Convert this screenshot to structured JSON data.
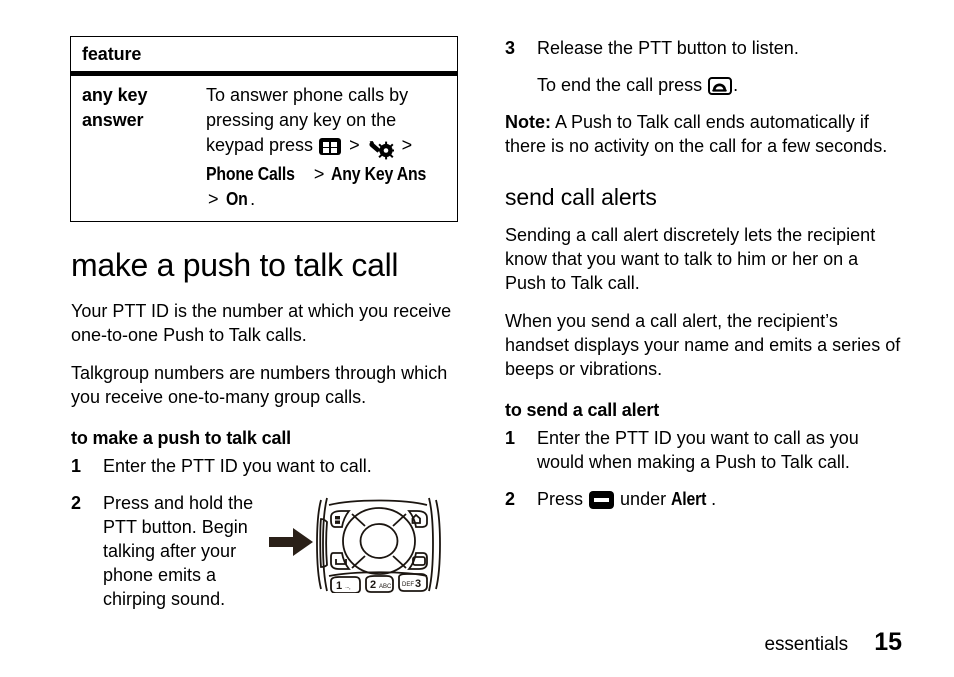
{
  "document": {
    "page_number": "15",
    "chapter_footer": "essentials"
  },
  "left_column": {
    "feature_table": {
      "header": "feature",
      "rows": [
        {
          "label": "any key answer",
          "label_line1": "any key",
          "label_line2": "answer",
          "description_prefix": "To answer phone calls by pressing any key on the keypad press",
          "menu_path": [
            "Phone Calls",
            "Any Key Ans",
            "On"
          ],
          "separator": ">",
          "trailing": ".",
          "icons": [
            "menu-icon",
            "tools-icon"
          ]
        }
      ]
    },
    "heading": "make a push to talk call",
    "paragraphs": [
      "Your PTT ID is the number at which you receive one-to-one Push to Talk calls.",
      "Talkgroup numbers are numbers through which you receive one-to-many group calls."
    ],
    "subheading": "to make a push to talk call",
    "steps": [
      {
        "num": "1",
        "text": "Enter the PTT ID you want to call."
      },
      {
        "num": "2",
        "text": "Press and hold the PTT button. Begin talking after your phone emits a chirping sound."
      }
    ],
    "figure": {
      "name": "phone-keypad-illustration",
      "arrow": "right-arrow",
      "keys": [
        "1",
        "2 ABC",
        "DEF 3"
      ],
      "callout": "PTT button on left side of phone"
    }
  },
  "right_column": {
    "steps_continued": [
      {
        "num": "3",
        "text": "Release the PTT button to listen."
      }
    ],
    "step3_sub_prefix": "To end the call press",
    "step3_sub_suffix": ".",
    "note_label": "Note:",
    "note_text": " A Push to Talk call ends automatically if there is no activity on the call for a few seconds.",
    "heading": "send call alerts",
    "paragraphs": [
      "Sending a call alert discretely lets the recipient know that you want to talk to him or her on a Push to Talk call.",
      "When you send a call alert, the recipient’s handset displays your name and emits a series of beeps or vibrations."
    ],
    "subheading": "to send a call alert",
    "steps": [
      {
        "num": "1",
        "text": "Enter the PTT ID you want to call as you would when making a Push to Talk call."
      }
    ],
    "step2": {
      "num": "2",
      "prefix": "Press",
      "middle": "under",
      "bold_label": "Alert",
      "suffix": "."
    }
  },
  "colors": {
    "text": "#000000",
    "background": "#ffffff",
    "arrow": "#2a2018",
    "rule": "#000000"
  }
}
